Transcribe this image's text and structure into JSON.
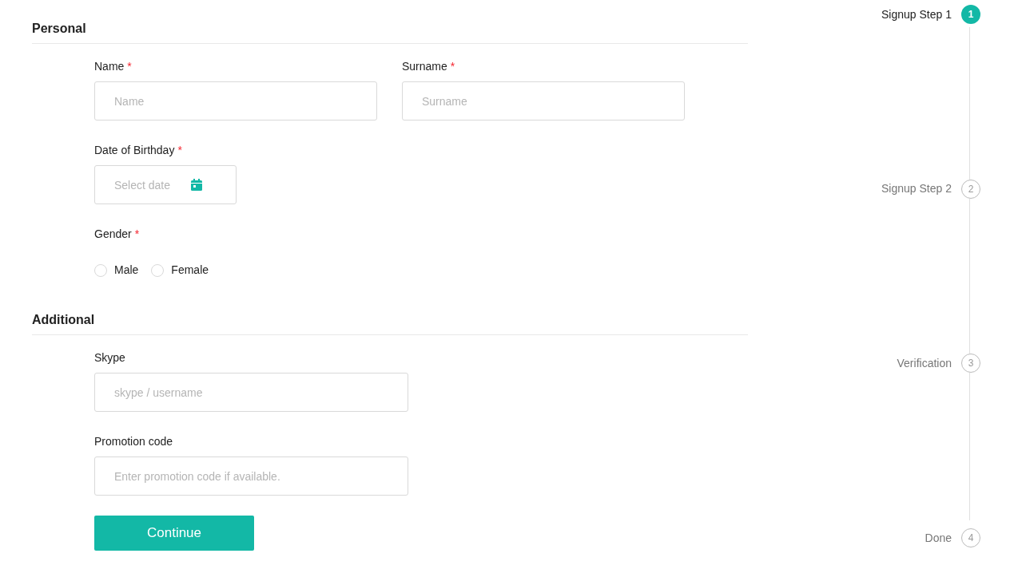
{
  "sections": [
    {
      "title": "Personal",
      "rows": [
        [
          {
            "kind": "text",
            "label": "Name",
            "mark": "*",
            "placeholder": "Name"
          },
          {
            "kind": "text",
            "label": "Surname",
            "mark": "*",
            "placeholder": "Surname"
          }
        ],
        [
          {
            "kind": "date",
            "label": "Date of Birthday",
            "mark": "*",
            "placeholder": "Select date"
          }
        ],
        [
          {
            "kind": "radio",
            "label": "Gender",
            "mark": "*",
            "options": [
              {
                "label": "Male",
                "selected": false
              },
              {
                "label": "Female",
                "selected": false
              }
            ]
          }
        ]
      ]
    },
    {
      "title": "Additional",
      "rows": [
        [
          {
            "kind": "text",
            "label": "Skype",
            "placeholder": "skype / username"
          }
        ],
        [
          {
            "kind": "text",
            "label": "Promotion code",
            "placeholder": "Enter promotion code if available."
          }
        ]
      ]
    }
  ],
  "button": "Continue",
  "steps": [
    {
      "label": "Signup Step 1",
      "number": "1",
      "selected": true
    },
    {
      "label": "Signup Step 2",
      "number": "2",
      "selected": false
    },
    {
      "label": "Verification",
      "number": "3",
      "selected": false
    },
    {
      "label": "Done",
      "number": "4",
      "selected": false
    }
  ]
}
